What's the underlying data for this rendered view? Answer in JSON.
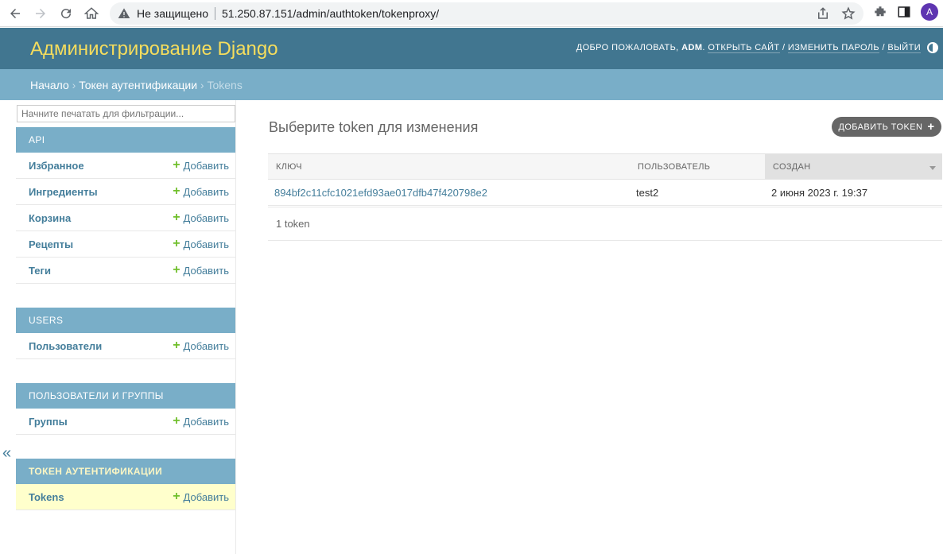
{
  "browser": {
    "insecure_label": "Не защищено",
    "url": "51.250.87.151/admin/authtoken/tokenproxy/",
    "profile_initial": "A"
  },
  "header": {
    "branding": "Администрирование Django",
    "welcome": "Добро пожаловать,",
    "username": "ADM",
    "view_site": "Открыть сайт",
    "change_password": "Изменить пароль",
    "logout": "Выйти"
  },
  "breadcrumbs": {
    "home": "Начало",
    "app": "Токен аутентификации",
    "current": "Tokens",
    "separator": "›"
  },
  "sidebar": {
    "filter_placeholder": "Начните печатать для фильтрации...",
    "add_label": "Добавить",
    "modules": [
      {
        "caption": "API",
        "items": [
          "Избранное",
          "Ингредиенты",
          "Корзина",
          "Рецепты",
          "Теги"
        ]
      },
      {
        "caption": "USERS",
        "items": [
          "Пользователи"
        ]
      },
      {
        "caption": "Пользователи и группы",
        "items": [
          "Группы"
        ]
      },
      {
        "caption": "Токен аутентификации",
        "items": [
          "Tokens"
        ]
      }
    ],
    "collapse": "«"
  },
  "content": {
    "title": "Выберите token для изменения",
    "add_button": "Добавить token",
    "columns": [
      "Ключ",
      "Пользователь",
      "Создан"
    ],
    "rows": [
      {
        "key": "894bf2c11cfc1021efd93ae017dfb47f420798e2",
        "user": "test2",
        "created": "2 июня 2023 г. 19:37"
      }
    ],
    "count": "1 token"
  },
  "colors": {
    "header_bg": "#417690",
    "breadcrumbs_bg": "#79aec8",
    "branding": "#f5dd5d",
    "link": "#447e9b",
    "add_plus": "#70bf2b",
    "selected_row": "#ffffcc"
  }
}
